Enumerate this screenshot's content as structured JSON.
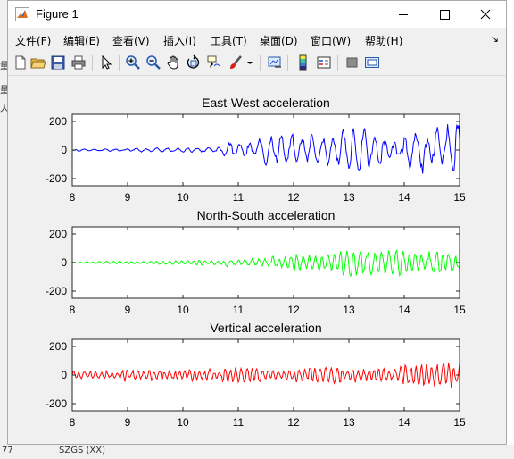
{
  "window": {
    "title": "Figure 1",
    "controls": {
      "minimize": "—",
      "maximize": "☐",
      "close": "✕"
    }
  },
  "menu": {
    "items": [
      "文件(F)",
      "编辑(E)",
      "查看(V)",
      "插入(I)",
      "工具(T)",
      "桌面(D)",
      "窗口(W)",
      "帮助(H)"
    ]
  },
  "toolbar": {
    "icons": [
      "new-figure-icon",
      "open-file-icon",
      "save-icon",
      "print-icon",
      "edit-plot-icon",
      "zoom-in-icon",
      "zoom-out-icon",
      "pan-icon",
      "rotate-3d-icon",
      "data-cursor-icon",
      "brush-icon",
      "brush-dropdown-icon",
      "link-plot-icon",
      "colorbar-icon",
      "legend-icon",
      "hide-plot-tools-icon",
      "show-plot-tools-icon"
    ]
  },
  "background": {
    "left_fragments": [
      "量",
      "量",
      "人"
    ],
    "bottom_fragments": [
      "77",
      "SZGS (XX)"
    ]
  },
  "colors": {
    "east_west": "#0000ff",
    "north_south": "#00ff00",
    "vertical": "#ff0000",
    "figure_bg": "#f0f0f0",
    "axes_bg": "#ffffff"
  },
  "chart_data": [
    {
      "type": "line",
      "title": "East-West acceleration",
      "xlim": [
        8,
        15
      ],
      "ylim": [
        -250,
        250
      ],
      "xticks": [
        8,
        9,
        10,
        11,
        12,
        13,
        14,
        15
      ],
      "yticks": [
        200,
        0,
        -200
      ],
      "envelope": {
        "x": [
          8,
          9,
          10,
          10.5,
          11,
          12,
          13,
          14,
          14.7,
          15
        ],
        "amplitude": [
          8,
          12,
          22,
          35,
          85,
          125,
          140,
          155,
          195,
          200
        ]
      },
      "series": [
        {
          "color": "#0000ff",
          "seed": 17,
          "cycles_per_unit": 5.4
        }
      ]
    },
    {
      "type": "line",
      "title": "North-South acceleration",
      "xlim": [
        8,
        15
      ],
      "ylim": [
        -250,
        250
      ],
      "xticks": [
        8,
        9,
        10,
        11,
        12,
        13,
        14,
        15
      ],
      "yticks": [
        200,
        0,
        -200
      ],
      "envelope": {
        "x": [
          8,
          9,
          10,
          11,
          12,
          13,
          13.8,
          14,
          15
        ],
        "amplitude": [
          8,
          12,
          18,
          38,
          60,
          85,
          150,
          115,
          110
        ]
      },
      "series": [
        {
          "color": "#00ff00",
          "seed": 53,
          "cycles_per_unit": 8.5
        }
      ]
    },
    {
      "type": "line",
      "title": "Vertical acceleration",
      "xlim": [
        8,
        15
      ],
      "ylim": [
        -250,
        250
      ],
      "xticks": [
        8,
        9,
        10,
        11,
        12,
        13,
        14,
        15
      ],
      "yticks": [
        200,
        0,
        -200
      ],
      "envelope": {
        "x": [
          8,
          9,
          10,
          11,
          12,
          13,
          14,
          15
        ],
        "amplitude": [
          32,
          42,
          42,
          52,
          60,
          68,
          80,
          85
        ]
      },
      "series": [
        {
          "color": "#ff0000",
          "seed": 91,
          "cycles_per_unit": 10.5
        }
      ]
    }
  ]
}
